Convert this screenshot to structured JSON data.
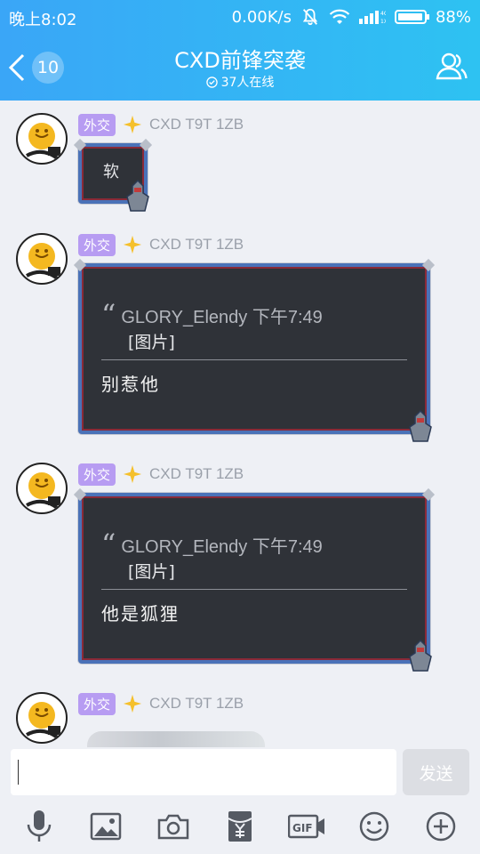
{
  "status_bar": {
    "time": "晚上8:02",
    "net_speed": "0.00K/s",
    "battery": "88%",
    "net_type_top": "4G",
    "net_type_bottom": "1X"
  },
  "header": {
    "unread_count": "10",
    "title": "CXD前锋突袭",
    "online": "37人在线"
  },
  "messages": [
    {
      "tag": "外交",
      "nick": "CXD T9T 1ZB",
      "text": "软"
    },
    {
      "tag": "外交",
      "nick": "CXD T9T 1ZB",
      "quote_user": "GLORY_Elendy 下午7:49",
      "quote_text": "[图片]",
      "text": "别惹他"
    },
    {
      "tag": "外交",
      "nick": "CXD T9T 1ZB",
      "quote_user": "GLORY_Elendy 下午7:49",
      "quote_text": "[图片]",
      "text": "他是狐狸"
    },
    {
      "tag": "外交",
      "nick": "CXD T9T 1ZB"
    }
  ],
  "input": {
    "value": "",
    "send_label": "发送"
  },
  "toolbar": {
    "items": [
      "microphone-icon",
      "image-icon",
      "camera-icon",
      "red-packet-icon",
      "gif-icon",
      "emoji-icon",
      "plus-icon"
    ],
    "gif_label": "GIF"
  },
  "colors": {
    "header_start": "#3aa6f7",
    "header_end": "#2ec2f2",
    "tag_bg": "#b79cf2",
    "bubble_bg": "#2f3238"
  }
}
